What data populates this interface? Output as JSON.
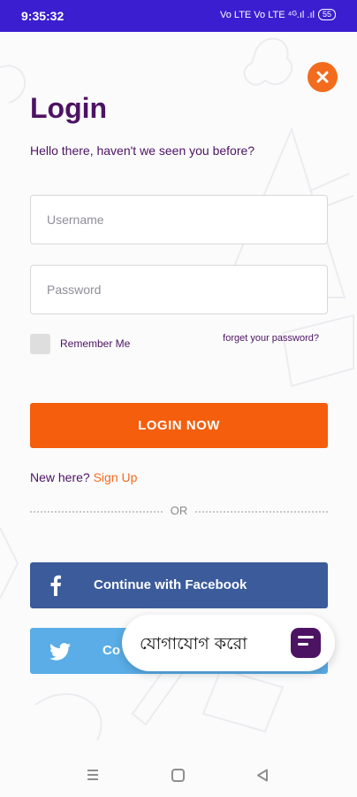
{
  "status_bar": {
    "time": "9:35:32",
    "indicators": "Vo LTE  Vo LTE  ⁴ᴳ.ıl .ıl",
    "battery": "55"
  },
  "login": {
    "title": "Login",
    "subtitle": "Hello there, haven't we seen you before?",
    "username_placeholder": "Username",
    "password_placeholder": "Password",
    "remember_me": "Remember Me",
    "forgot_password": "forget your password?",
    "login_button": "LOGIN NOW",
    "new_here": "New here?",
    "sign_up": "Sign Up",
    "or": "OR"
  },
  "social": {
    "facebook": "Continue with Facebook",
    "twitter": "Co"
  },
  "contact": {
    "label": "যোগাযোগ করো"
  },
  "colors": {
    "status_bar": "#3b1ed0",
    "accent_orange": "#f45e0d",
    "title_purple": "#4d1363",
    "facebook_blue": "#3b5b9b",
    "twitter_blue": "#5aade6"
  },
  "icons": [
    "close-icon",
    "facebook-icon",
    "twitter-icon",
    "chat-icon",
    "recents-icon",
    "home-icon",
    "back-icon"
  ]
}
